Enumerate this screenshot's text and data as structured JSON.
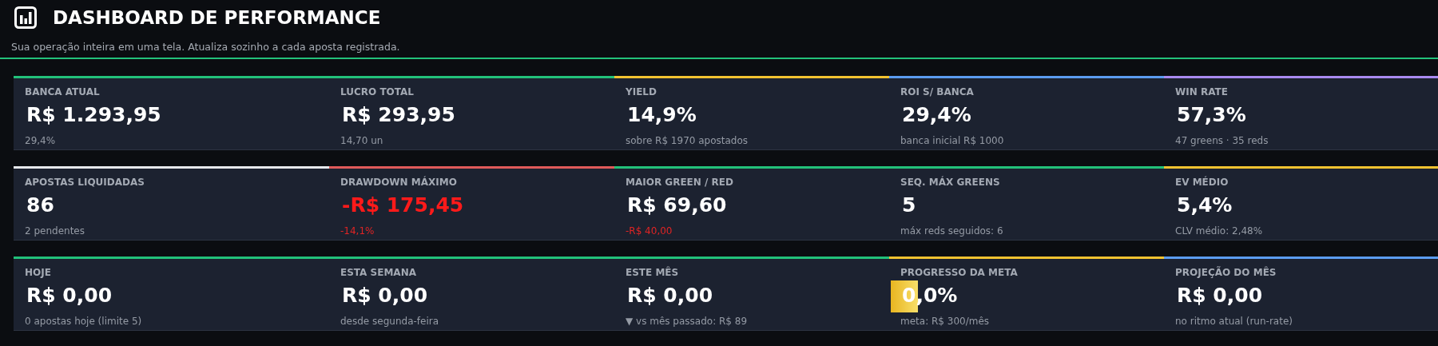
{
  "header": {
    "title": "DASHBOARD DE PERFORMANCE",
    "subtitle": "Sua operação inteira em uma tela. Atualiza sozinho a cada aposta registrada."
  },
  "rows": [
    {
      "cards": [
        {
          "label": "BANCA ATUAL",
          "value": "R$ 1.293,95",
          "sub": "29,4%",
          "color": "#22c17a",
          "negative": false,
          "sub_negative": false
        },
        {
          "label": "LUCRO TOTAL",
          "value": "R$ 293,95",
          "sub": "14,70 un",
          "color": "#22c17a",
          "negative": false,
          "sub_negative": false
        },
        {
          "label": "YIELD",
          "value": "14,9%",
          "sub": "sobre R$ 1970 apostados",
          "color": "#f2c230",
          "negative": false,
          "sub_negative": false
        },
        {
          "label": "ROI S/ BANCA",
          "value": "29,4%",
          "sub": "banca inicial R$ 1000",
          "color": "#5b9cf0",
          "negative": false,
          "sub_negative": false
        },
        {
          "label": "WIN RATE",
          "value": "57,3%",
          "sub": "47 greens · 35 reds",
          "color": "#a98af0",
          "negative": false,
          "sub_negative": false
        }
      ]
    },
    {
      "cards": [
        {
          "label": "APOSTAS LIQUIDADAS",
          "value": "86",
          "sub": "2 pendentes",
          "color": "#e6e8ec",
          "negative": false,
          "sub_negative": false
        },
        {
          "label": "DRAWDOWN MÁXIMO",
          "value": "-R$ 175,45",
          "sub": "-14,1%",
          "color": "#e05a5a",
          "negative": true,
          "sub_negative": true
        },
        {
          "label": "MAIOR GREEN / RED",
          "value": "R$ 69,60",
          "sub": "-R$ 40,00",
          "color": "#22c17a",
          "negative": false,
          "sub_negative": true
        },
        {
          "label": "SEQ. MÁX GREENS",
          "value": "5",
          "sub": "máx reds seguidos: 6",
          "color": "#22c17a",
          "negative": false,
          "sub_negative": false
        },
        {
          "label": "EV MÉDIO",
          "value": "5,4%",
          "sub": "CLV médio: 2,48%",
          "color": "#f2c230",
          "negative": false,
          "sub_negative": false
        }
      ]
    },
    {
      "cards": [
        {
          "label": "HOJE",
          "value": "R$ 0,00",
          "sub": "0 apostas hoje (limite 5)",
          "color": "#22c17a",
          "negative": false,
          "sub_negative": false
        },
        {
          "label": "ESTA SEMANA",
          "value": "R$ 0,00",
          "sub": "desde segunda-feira",
          "color": "#22c17a",
          "negative": false,
          "sub_negative": false
        },
        {
          "label": "ESTE MÊS",
          "value": "R$ 0,00",
          "sub": "▼ vs mês passado: R$ 89",
          "color": "#22c17a",
          "negative": false,
          "sub_negative": false
        },
        {
          "label": "PROGRESSO DA META",
          "value": "0,0%",
          "sub": "meta: R$ 300/mês",
          "color": "#f2c230",
          "negative": false,
          "sub_negative": false,
          "kind": "progress",
          "level": 0
        },
        {
          "label": "PROJEÇÃO DO MÊS",
          "value": "R$ 0,00",
          "sub": "no ritmo atual (run-rate)",
          "color": "#5b9cf0",
          "negative": false,
          "sub_negative": false
        }
      ]
    }
  ]
}
